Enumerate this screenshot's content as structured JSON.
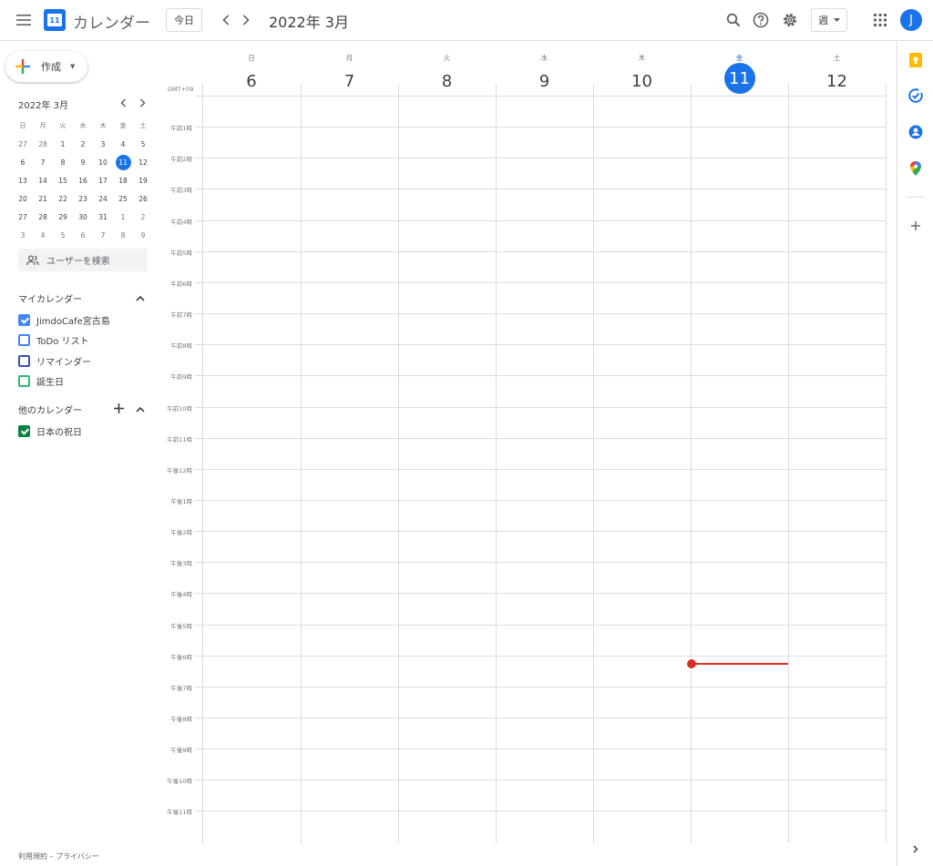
{
  "header": {
    "app_logo_num": "11",
    "app_title": "カレンダー",
    "today_label": "今日",
    "period": "2022年 3月",
    "view_label": "週",
    "avatar_initial": "J"
  },
  "sidebar": {
    "create_label": "作成",
    "mini_calendar": {
      "title": "2022年 3月",
      "weekdays": [
        "日",
        "月",
        "火",
        "水",
        "木",
        "金",
        "土"
      ],
      "weeks": [
        [
          "27",
          "28",
          "1",
          "2",
          "3",
          "4",
          "5"
        ],
        [
          "6",
          "7",
          "8",
          "9",
          "10",
          "11",
          "12"
        ],
        [
          "13",
          "14",
          "15",
          "16",
          "17",
          "18",
          "19"
        ],
        [
          "20",
          "21",
          "22",
          "23",
          "24",
          "25",
          "26"
        ],
        [
          "27",
          "28",
          "29",
          "30",
          "31",
          "1",
          "2"
        ],
        [
          "3",
          "4",
          "5",
          "6",
          "7",
          "8",
          "9"
        ]
      ]
    },
    "people_search_placeholder": "ユーザーを検索",
    "my_calendars_title": "マイカレンダー",
    "my_calendars": [
      {
        "label": "JimdoCafe宮古島",
        "color": "#4285f4",
        "checked": true
      },
      {
        "label": "ToDo リスト",
        "color": "#4285f4",
        "checked": false
      },
      {
        "label": "リマインダー",
        "color": "#3f51b5",
        "checked": false
      },
      {
        "label": "誕生日",
        "color": "#33b679",
        "checked": false
      }
    ],
    "other_calendars_title": "他のカレンダー",
    "other_calendars": [
      {
        "label": "日本の祝日",
        "color": "#0b8043",
        "checked": true
      }
    ],
    "footer": "利用規約 – プライバシー"
  },
  "week": {
    "timezone": "GMT+09",
    "days": [
      {
        "name": "日",
        "num": "6"
      },
      {
        "name": "月",
        "num": "7"
      },
      {
        "name": "火",
        "num": "8"
      },
      {
        "name": "水",
        "num": "9"
      },
      {
        "name": "木",
        "num": "10"
      },
      {
        "name": "金",
        "num": "11",
        "today": true
      },
      {
        "name": "土",
        "num": "12"
      }
    ],
    "hours": [
      "午前1時",
      "午前2時",
      "午前3時",
      "午前4時",
      "午前5時",
      "午前6時",
      "午前7時",
      "午前8時",
      "午前9時",
      "午前10時",
      "午前11時",
      "午後12時",
      "午後1時",
      "午後2時",
      "午後3時",
      "午後4時",
      "午後5時",
      "午後6時",
      "午後7時",
      "午後8時",
      "午後9時",
      "午後10時",
      "午後11時"
    ]
  },
  "colors": {
    "accent": "#1a73e8",
    "now_indicator": "#d93025"
  }
}
